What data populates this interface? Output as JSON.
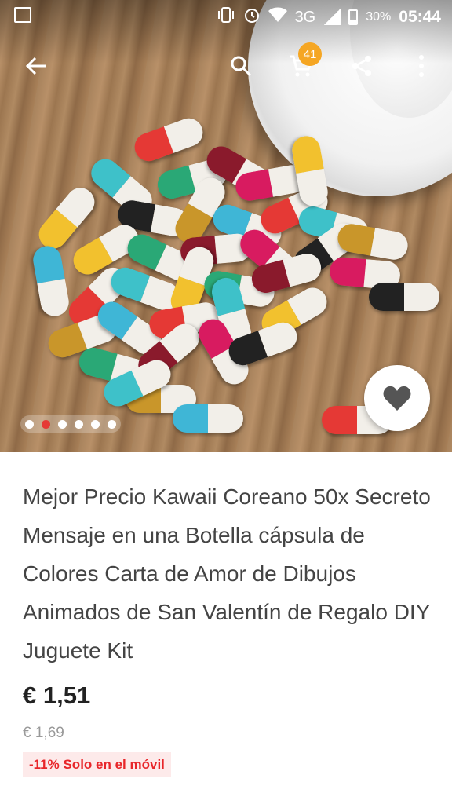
{
  "status_bar": {
    "battery_percent": "30%",
    "network": "3G",
    "time": "05:44"
  },
  "toolbar": {
    "back_icon": "arrow-back-icon",
    "search_icon": "search-icon",
    "cart_icon": "cart-icon",
    "cart_count": "41",
    "share_icon": "share-icon",
    "more_icon": "more-vert-icon"
  },
  "gallery": {
    "image_count": 6,
    "active_index": 1,
    "favorite_icon": "heart-icon"
  },
  "product": {
    "title": "Mejor Precio Kawaii Coreano 50x Secreto Mensaje en una Botella cápsula de Colores Carta de Amor de Dibujos Animados de San Valentín de Regalo DIY Juguete Kit",
    "price": "€ 1,51",
    "original_price": "€ 1,69",
    "promo_label": "-11% Solo en el móvil"
  },
  "colors": {
    "accent_red": "#e53935",
    "badge_orange": "#f5a623",
    "promo_text": "#e8262a",
    "promo_bg": "#fdeaea"
  }
}
